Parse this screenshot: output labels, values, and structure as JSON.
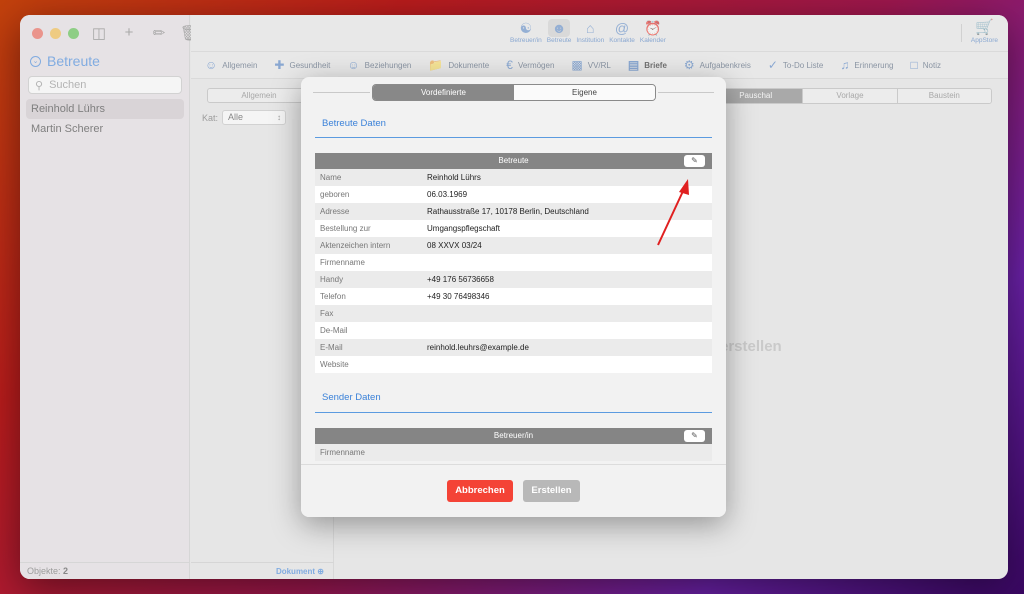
{
  "sidebar": {
    "title": "Betreute",
    "search_placeholder": "Suchen",
    "items": [
      "Reinhold Lührs",
      "Martin Scherer"
    ],
    "footer_label": "Objekte:",
    "footer_count": "2"
  },
  "toolbar": {
    "buttons": [
      "Betreuer/in",
      "Betreute",
      "Institution",
      "Kontakte",
      "Kalender"
    ],
    "appstore": "AppStore"
  },
  "categories": [
    "Allgemein",
    "Gesundheit",
    "Beziehungen",
    "Dokumente",
    "Vermögen",
    "VV/RL",
    "Briefe",
    "Aufgabenkreis",
    "To-Do Liste",
    "Erinnerung",
    "Notiz"
  ],
  "content": {
    "left_segment": "Allgemein",
    "kat_label": "Kat:",
    "kat_value": "Alle",
    "footer_doc": "Dokument",
    "right_segments": [
      "Pauschal",
      "Vorlage",
      "Baustein"
    ],
    "ghost_text": "erstellen"
  },
  "modal": {
    "tabs": [
      "Vordefinierte",
      "Eigene"
    ],
    "section1_title": "Betreute Daten",
    "table1_header": "Betreute",
    "table1_rows": [
      {
        "label": "Name",
        "value": "Reinhold Lührs"
      },
      {
        "label": "geboren",
        "value": "06.03.1969"
      },
      {
        "label": "Adresse",
        "value": "Rathausstraße 17, 10178 Berlin, Deutschland"
      },
      {
        "label": "Bestellung zur",
        "value": "Umgangspflegschaft"
      },
      {
        "label": "Aktenzeichen intern",
        "value": "08 XXVX 03/24"
      },
      {
        "label": "Firmenname",
        "value": ""
      },
      {
        "label": "Handy",
        "value": "+49 176 56736658"
      },
      {
        "label": "Telefon",
        "value": "+49 30 76498346"
      },
      {
        "label": "Fax",
        "value": ""
      },
      {
        "label": "De-Mail",
        "value": ""
      },
      {
        "label": "E-Mail",
        "value": "reinhold.leuhrs@example.de"
      },
      {
        "label": "Website",
        "value": ""
      }
    ],
    "section2_title": "Sender Daten",
    "table2_header": "Betreuer/in",
    "table2_rows": [
      {
        "label": "Firmenname",
        "value": ""
      }
    ],
    "cancel_label": "Abbrechen",
    "create_label": "Erstellen"
  },
  "colors": {
    "accent": "#3b82d9",
    "danger": "#f44336",
    "annotation_arrow": "#e02020"
  }
}
